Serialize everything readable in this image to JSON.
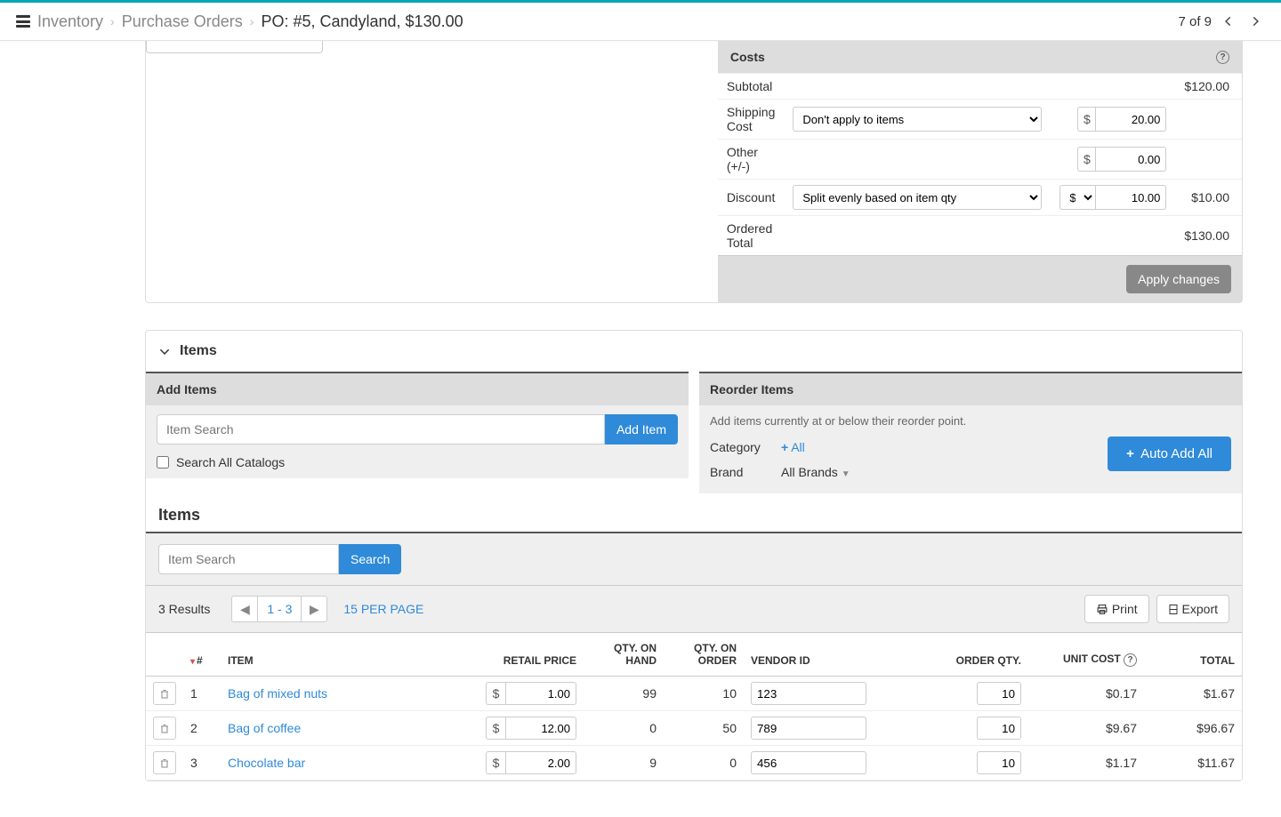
{
  "breadcrumb": {
    "inventory": "Inventory",
    "purchase_orders": "Purchase Orders",
    "current": "PO:  #5, Candyland, $130.00"
  },
  "pager": {
    "text": "7 of 9"
  },
  "costs": {
    "header": "Costs",
    "subtotal_label": "Subtotal",
    "subtotal": "$120.00",
    "shipping_label": "Shipping Cost",
    "shipping_select": "Don't apply to items",
    "shipping_currency": "$",
    "shipping_amount": "20.00",
    "other_label": "Other (+/-)",
    "other_currency": "$",
    "other_amount": "0.00",
    "discount_label": "Discount",
    "discount_select": "Split evenly based on item qty",
    "discount_type": "$",
    "discount_amount": "10.00",
    "discount_computed": "$10.00",
    "total_label": "Ordered Total",
    "total": "$130.00",
    "apply_btn": "Apply changes"
  },
  "items_section": {
    "title": "Items"
  },
  "add_items": {
    "header": "Add Items",
    "placeholder": "Item Search",
    "button": "Add Item",
    "checkbox_label": "Search All Catalogs"
  },
  "reorder": {
    "header": "Reorder Items",
    "hint": "Add items currently at or below their reorder point.",
    "category_label": "Category",
    "all_link": "All",
    "brand_label": "Brand",
    "brand_value": "All Brands",
    "auto_add": "Auto Add All"
  },
  "items_list": {
    "title": "Items",
    "search_placeholder": "Item Search",
    "search_btn": "Search",
    "results": "3 Results",
    "page_range": "1 - 3",
    "per_page": "15 PER PAGE",
    "print": "Print",
    "export": "Export",
    "columns": {
      "num": "#",
      "item": "ITEM",
      "retail": "RETAIL PRICE",
      "on_hand": "QTY. ON HAND",
      "on_order": "QTY. ON ORDER",
      "vendor_id": "VENDOR ID",
      "order_qty": "ORDER QTY.",
      "unit_cost": "UNIT COST",
      "total": "TOTAL"
    },
    "rows": [
      {
        "num": "1",
        "item": "Bag of mixed nuts",
        "retail": "1.00",
        "on_hand": "99",
        "on_order": "10",
        "vendor_id": "123",
        "order_qty": "10",
        "unit_cost": "$0.17",
        "total": "$1.67"
      },
      {
        "num": "2",
        "item": "Bag of coffee",
        "retail": "12.00",
        "on_hand": "0",
        "on_order": "50",
        "vendor_id": "789",
        "order_qty": "10",
        "unit_cost": "$9.67",
        "total": "$96.67"
      },
      {
        "num": "3",
        "item": "Chocolate bar",
        "retail": "2.00",
        "on_hand": "9",
        "on_order": "0",
        "vendor_id": "456",
        "order_qty": "10",
        "unit_cost": "$1.17",
        "total": "$11.67"
      }
    ]
  }
}
